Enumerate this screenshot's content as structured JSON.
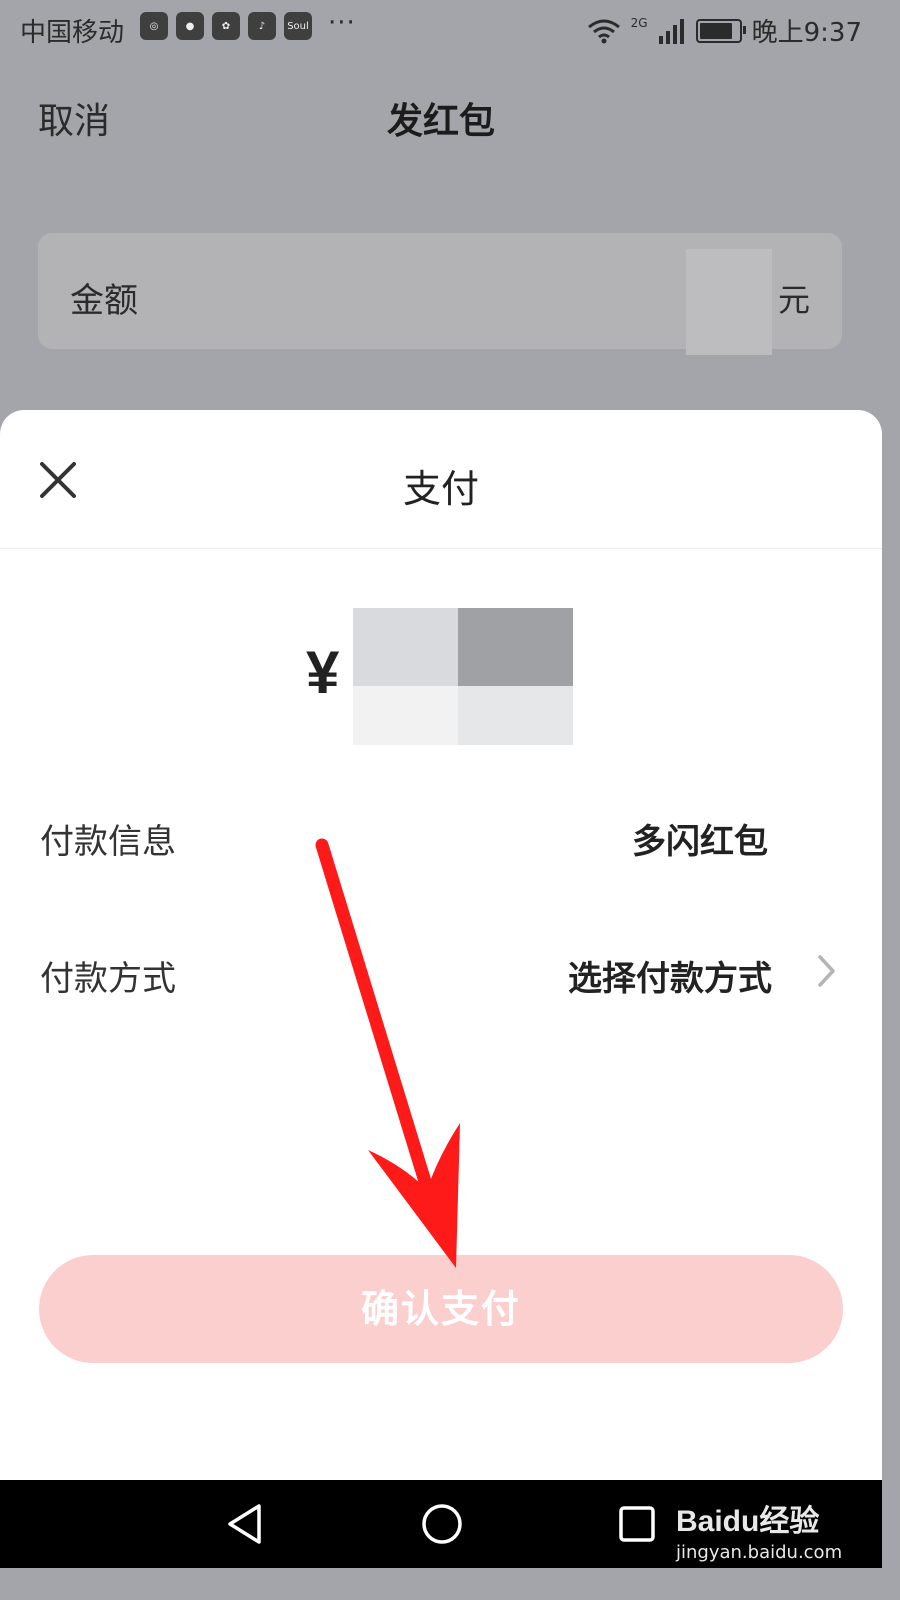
{
  "status_bar": {
    "carrier": "中国移动",
    "app_icons": [
      "app-icon-1",
      "app-icon-2",
      "huawei-icon",
      "tiktok-icon",
      "soul-icon"
    ],
    "soul_label": "Soul",
    "more": "···",
    "network": "2G",
    "battery_level": 0.85,
    "time": "晚上9:37"
  },
  "background_page": {
    "cancel_label": "取消",
    "title": "发红包",
    "amount_label": "金额",
    "amount_unit": "元"
  },
  "payment_sheet": {
    "title": "支付",
    "currency_symbol": "¥",
    "payment_info_label": "付款信息",
    "payment_info_value": "多闪红包",
    "payment_method_label": "付款方式",
    "payment_method_value": "选择付款方式",
    "confirm_button": "确认支付"
  },
  "colors": {
    "overlay": "#a4a4ab",
    "confirm_button_disabled": "#fccfcf",
    "annotation_arrow": "#ff1a1a"
  },
  "watermark": {
    "brand": "Baidu经验",
    "url": "jingyan.baidu.com"
  }
}
